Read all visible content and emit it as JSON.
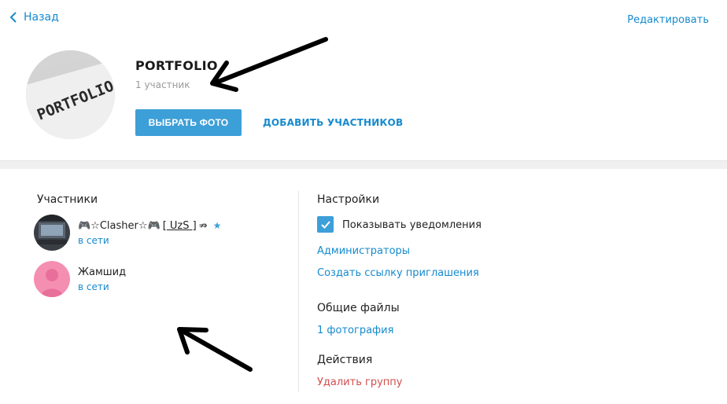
{
  "nav": {
    "back_label": "Назад",
    "edit_label": "Редактировать"
  },
  "group": {
    "title": "PORTFOLIO",
    "subtitle": "1 участник",
    "avatar_text": "PORTFOLIO",
    "choose_photo_label": "ВЫБРАТЬ ФОТО",
    "add_members_label": "ДОБАВИТЬ УЧАСТНИКОВ"
  },
  "members": {
    "title": "Участники",
    "items": [
      {
        "name_a": "🎮☆Clasher☆🎮",
        "name_b": "[ UzS ]",
        "name_c": "⇏",
        "status": "в сети",
        "admin_icon": "star-icon"
      },
      {
        "name_a": "Жамшид",
        "status": "в сети"
      }
    ]
  },
  "settings": {
    "title": "Настройки",
    "notifications_label": "Показывать уведомления",
    "notifications_checked": true,
    "admins_link": "Администраторы",
    "invite_link": "Создать ссылку приглашения"
  },
  "files": {
    "title": "Общие файлы",
    "photos_link": "1 фотография"
  },
  "actions": {
    "title": "Действия",
    "delete_link": "Удалить группу"
  },
  "colors": {
    "accent": "#3d9fd8",
    "link": "#168acd",
    "danger": "#d14e4e",
    "avatar_pink": "#f48fb1"
  }
}
